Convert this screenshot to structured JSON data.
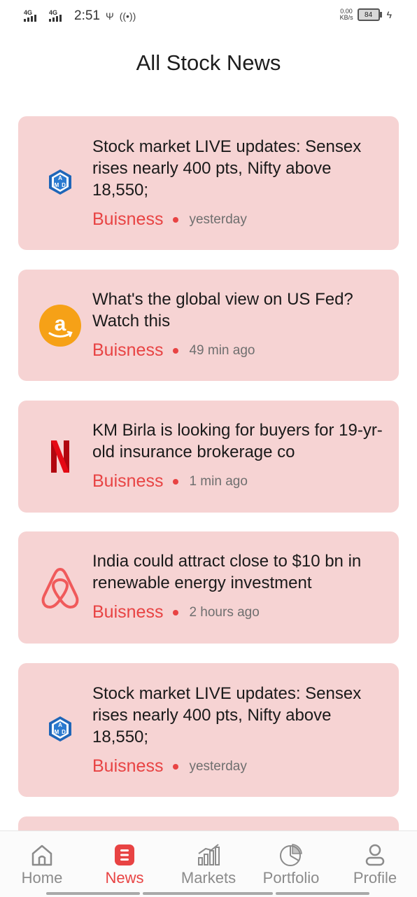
{
  "status_bar": {
    "network_1": "4G",
    "network_2": "4G",
    "time": "2:51",
    "speed_value": "0.00",
    "speed_unit": "KB/s",
    "battery": "84"
  },
  "page": {
    "title": "All Stock News"
  },
  "news": [
    {
      "logo": "amd-logo-icon",
      "headline": "Stock market LIVE updates: Sensex rises nearly 400 pts, Nifty above 18,550;",
      "category": "Buisness",
      "time": "yesterday"
    },
    {
      "logo": "amazon-logo-icon",
      "headline": "What's the global view on US Fed? Watch this",
      "category": "Buisness",
      "time": "49 min ago"
    },
    {
      "logo": "netflix-logo-icon",
      "headline": "KM Birla is looking for buyers for 19-yr-old insurance brokerage co",
      "category": "Buisness",
      "time": "1 min ago"
    },
    {
      "logo": "airbnb-logo-icon",
      "headline": "India could attract close to $10 bn in renewable energy investment",
      "category": "Buisness",
      "time": "2 hours ago"
    },
    {
      "logo": "amd-logo-icon",
      "headline": "Stock market LIVE updates: Sensex rises nearly 400 pts, Nifty above 18,550;",
      "category": "Buisness",
      "time": "yesterday"
    }
  ],
  "nav": {
    "items": [
      {
        "label": "Home",
        "icon": "home-icon"
      },
      {
        "label": "News",
        "icon": "news-icon",
        "active": true
      },
      {
        "label": "Markets",
        "icon": "markets-icon"
      },
      {
        "label": "Portfolio",
        "icon": "portfolio-icon"
      },
      {
        "label": "Profile",
        "icon": "profile-icon"
      }
    ]
  },
  "colors": {
    "accent": "#e84343",
    "card_bg": "#f6d3d3",
    "inactive": "#8b8b8b"
  }
}
